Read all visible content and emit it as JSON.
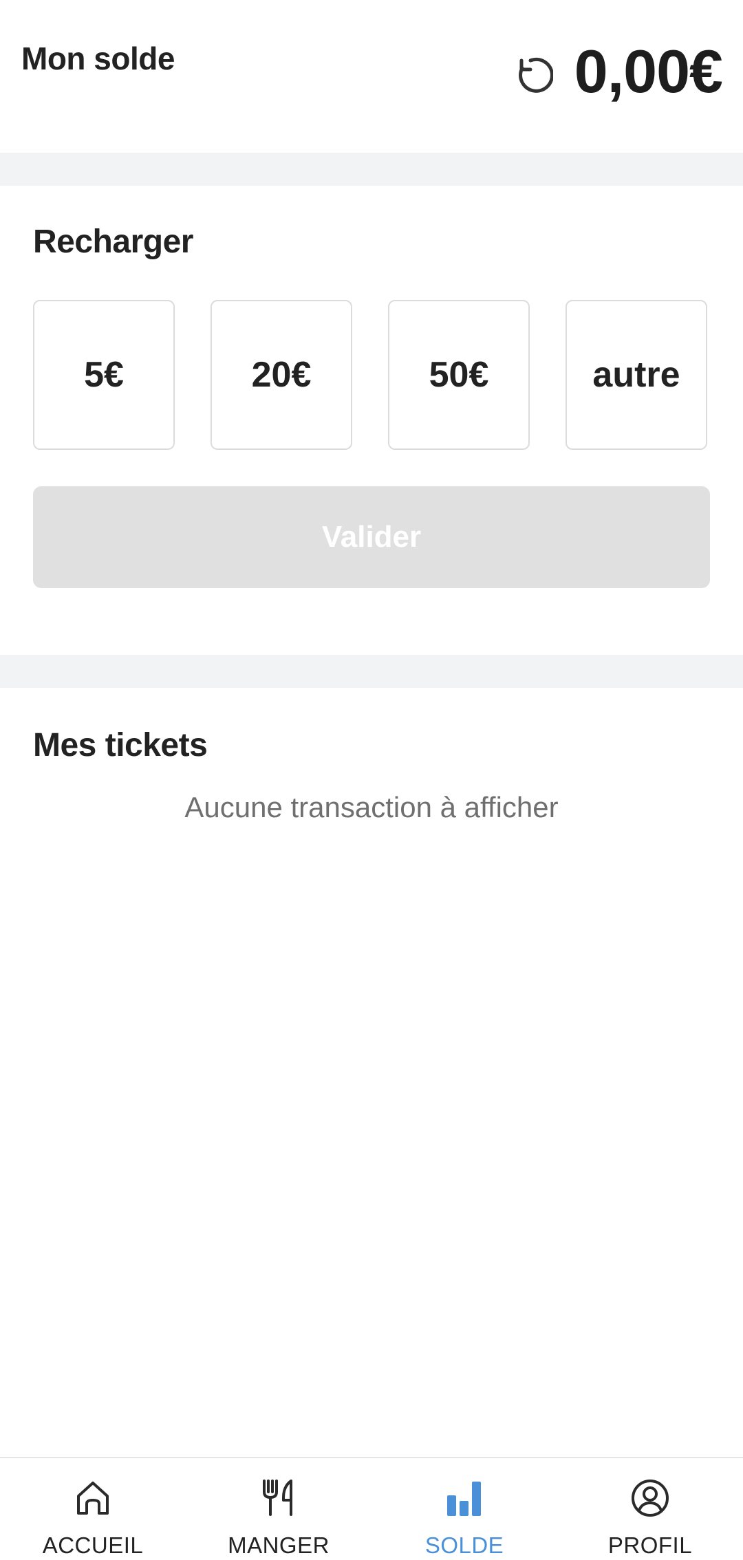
{
  "balance": {
    "title": "Mon solde",
    "amount": "0,00€",
    "refresh_icon": "refresh-icon"
  },
  "recharge": {
    "title": "Recharger",
    "options": [
      {
        "label": "5€"
      },
      {
        "label": "20€"
      },
      {
        "label": "50€"
      },
      {
        "label": "autre"
      }
    ],
    "validate_label": "Valider",
    "validate_state": "disabled"
  },
  "tickets": {
    "title": "Mes tickets",
    "empty_message": "Aucune transaction à afficher"
  },
  "nav": {
    "active_index": 2,
    "active_color": "#4a90d9",
    "items": [
      {
        "label": "ACCUEIL",
        "icon": "home-icon"
      },
      {
        "label": "MANGER",
        "icon": "fork-knife-icon"
      },
      {
        "label": "SOLDE",
        "icon": "bar-chart-icon"
      },
      {
        "label": "PROFIL",
        "icon": "user-circle-icon"
      }
    ]
  },
  "colors": {
    "divider": "#f2f3f4",
    "validate_disabled_bg": "#e0e0e0",
    "text_primary": "#222222",
    "text_muted": "#6f6f6f"
  }
}
